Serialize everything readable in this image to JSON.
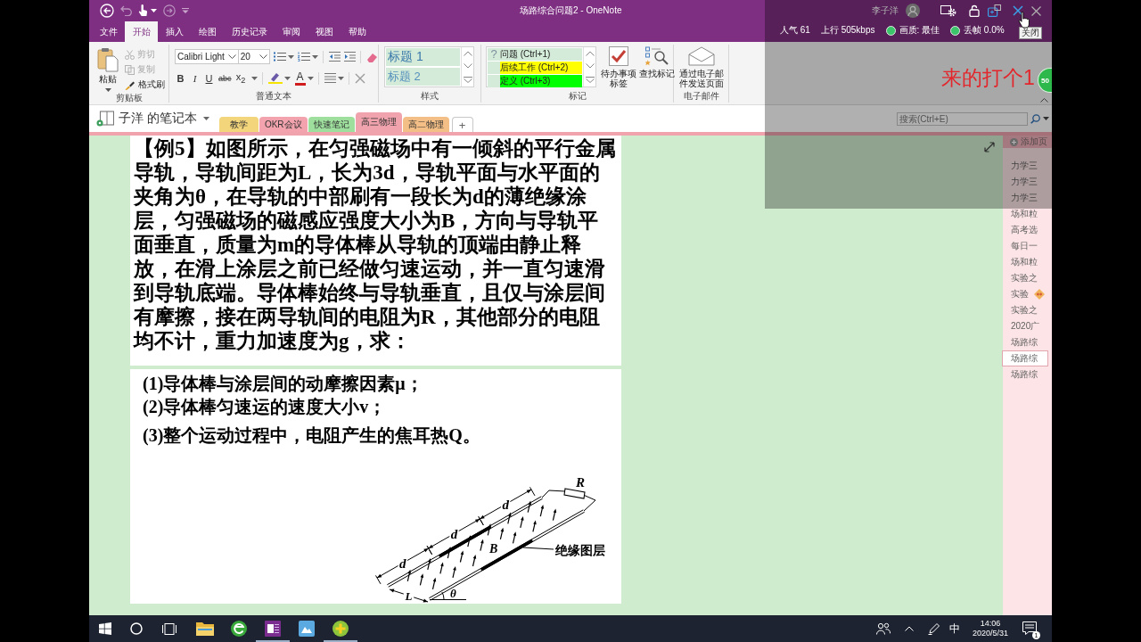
{
  "title_bar": {
    "title": "场路综合问题2 - OneNote",
    "user_name": "李子洋"
  },
  "menu": [
    {
      "label": "文件",
      "selected": false
    },
    {
      "label": "开始",
      "selected": true
    },
    {
      "label": "插入",
      "selected": false
    },
    {
      "label": "绘图",
      "selected": false
    },
    {
      "label": "历史记录",
      "selected": false
    },
    {
      "label": "审阅",
      "selected": false
    },
    {
      "label": "视图",
      "selected": false
    },
    {
      "label": "帮助",
      "selected": false
    }
  ],
  "ribbon": {
    "clipboard": {
      "label": "剪贴板",
      "paste": "粘贴",
      "tools": [
        {
          "kind": "cut",
          "label": "剪切",
          "disabled": true
        },
        {
          "kind": "copy",
          "label": "复制",
          "disabled": true
        },
        {
          "kind": "painter",
          "label": "格式刷",
          "disabled": false
        }
      ]
    },
    "basic_text": {
      "label": "普通文本",
      "font": "Calibri Light",
      "size": "20",
      "format_buttons": [
        {
          "kind": "bold",
          "text": "B"
        },
        {
          "kind": "italic",
          "text": "I"
        },
        {
          "kind": "underline",
          "text": "U"
        },
        {
          "kind": "strike",
          "text": "abc"
        },
        {
          "kind": "subscript",
          "text": "x$_{2}$"
        }
      ],
      "font_color_button": "A"
    },
    "styles": {
      "label": "样式",
      "items": [
        "标题 1",
        "标题 2"
      ]
    },
    "tags": {
      "label": "标记",
      "items": [
        {
          "kind": "symbol",
          "symbol": "?",
          "label": "问题 (Ctrl+1)"
        },
        {
          "kind": "highlight",
          "color": "#ffff00",
          "label": "后续工作 (Ctrl+2)"
        },
        {
          "kind": "highlight",
          "color": "#00ff00",
          "label": "定义 (Ctrl+3)"
        }
      ],
      "todo_tag": "待办事项标签",
      "find_tags": "查找标记"
    },
    "email": {
      "label": "电子邮件",
      "send_page": "通过电子邮件发送页面"
    }
  },
  "notebook_bar": {
    "notebook": "子洋 的笔记本",
    "sections": [
      {
        "label": "教学",
        "color": "#f3d57c",
        "selected": false
      },
      {
        "label": "OKR会议",
        "color": "#f2a3ad",
        "selected": false
      },
      {
        "label": "快速笔记",
        "color": "#9edf9e",
        "selected": false
      },
      {
        "label": "高三物理",
        "color": "#f0a3ad",
        "selected": true
      },
      {
        "label": "高二物理",
        "color": "#f4bf86",
        "selected": false
      }
    ],
    "add_section": "+",
    "search": {
      "placeholder": "搜索(Ctrl+E)"
    }
  },
  "page": {
    "problem": "【例5】如图所示，在匀强磁场中有一倾斜的平行金属导轨，导轨间距为L，长为3d，导轨平面与水平面的夹角为θ，在导轨的中部刷有一段长为d的薄绝缘涂层，匀强磁场的磁感应强度大小为B，方向与导轨平面垂直，质量为m的导体棒从导轨的顶端由静止释放，在滑上涂层之前已经做匀速运动，并一直匀速滑到导轨底端。导体棒始终与导轨垂直，且仅与涂层间有摩擦，接在两导轨间的电阻为R，其他部分的电阻均不计，重力加速度为g，求：",
    "questions": [
      "(1)导体棒与涂层间的动摩擦因素μ；",
      "(2)导体棒匀速运的速度大小v；",
      "(3)整个运动过程中，电阻产生的焦耳热Q。"
    ],
    "figure": {
      "resistor_label": "R",
      "segment_labels": [
        "d",
        "d",
        "d"
      ],
      "field_label": "B",
      "gap_label": "L",
      "angle_label": "θ",
      "coating_label": "绝缘图层"
    }
  },
  "page_list": {
    "add_page": "添加页",
    "pages": [
      {
        "title": "力学三",
        "selected": false,
        "tagged": false
      },
      {
        "title": "力学三",
        "selected": false,
        "tagged": false
      },
      {
        "title": "力学三",
        "selected": false,
        "tagged": false
      },
      {
        "title": "场和粒",
        "selected": false,
        "tagged": false
      },
      {
        "title": "高考选",
        "selected": false,
        "tagged": false
      },
      {
        "title": "每日一",
        "selected": false,
        "tagged": false
      },
      {
        "title": "场和粒",
        "selected": false,
        "tagged": false
      },
      {
        "title": "实验之",
        "selected": false,
        "tagged": false
      },
      {
        "title": "实验",
        "selected": false,
        "tagged": true
      },
      {
        "title": "实验之",
        "selected": false,
        "tagged": false
      },
      {
        "title": "2020广",
        "selected": false,
        "tagged": false
      },
      {
        "title": "场路综",
        "selected": false,
        "tagged": false
      },
      {
        "title": "场路综",
        "selected": true,
        "tagged": false
      },
      {
        "title": "场路综",
        "selected": false,
        "tagged": false
      }
    ]
  },
  "stream_overlay": {
    "stats": [
      {
        "kind": "plain",
        "text": "人气 61"
      },
      {
        "kind": "plain",
        "text": "上行 505kbps"
      },
      {
        "kind": "dot",
        "color": "#3cc46a",
        "text": "画质: 最佳"
      },
      {
        "kind": "dot",
        "color": "#3cc46a",
        "text": "丢帧 0.0%"
      }
    ],
    "tooltip": "关闭",
    "comment": "来的打个1",
    "badge": "50"
  },
  "taskbar": {
    "apps": [
      {
        "kind": "explorer",
        "running": false
      },
      {
        "kind": "browser",
        "running": false
      },
      {
        "kind": "onenote",
        "running": true
      },
      {
        "kind": "picture",
        "running": false
      },
      {
        "kind": "plus",
        "running": true
      }
    ],
    "ime": "中",
    "time": "14:06",
    "date": "2020/5/31",
    "notifications": "1"
  }
}
